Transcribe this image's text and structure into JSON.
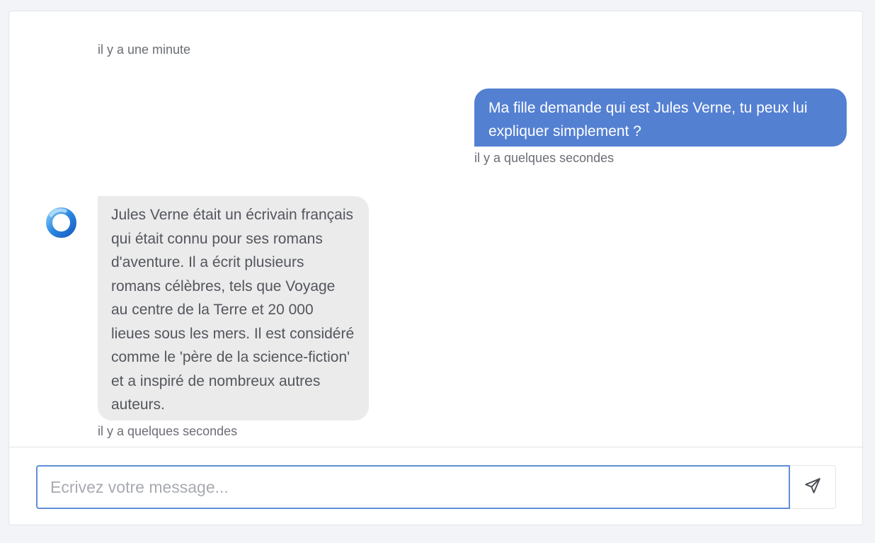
{
  "messages": [
    {
      "sender": "user",
      "text": "Ma fille demande qui est Jules Verne, tu peux lui expliquer simplement ?",
      "timestamp": "il y a quelques secondes"
    },
    {
      "sender": "assistant",
      "text": "Jules Verne était un écrivain français qui était connu pour ses romans d'aventure. Il a écrit plusieurs romans célèbres, tels que Voyage au centre de la Terre et 20 000 lieues sous les mers. Il est considéré comme le 'père de la science-fiction' et a inspiré de nombreux autres auteurs.",
      "timestamp": "il y a quelques secondes"
    }
  ],
  "earlier_timestamp": "il y a une minute",
  "composer": {
    "placeholder": "Ecrivez votre message...",
    "value": ""
  },
  "icons": {
    "avatar": "assistant-logo-icon",
    "send": "send-icon"
  },
  "colors": {
    "user_bubble": "#5480d2",
    "assistant_bubble": "#ebebeb",
    "input_focus_border": "#5f8fd8",
    "avatar_blue": "#2b86e0"
  }
}
